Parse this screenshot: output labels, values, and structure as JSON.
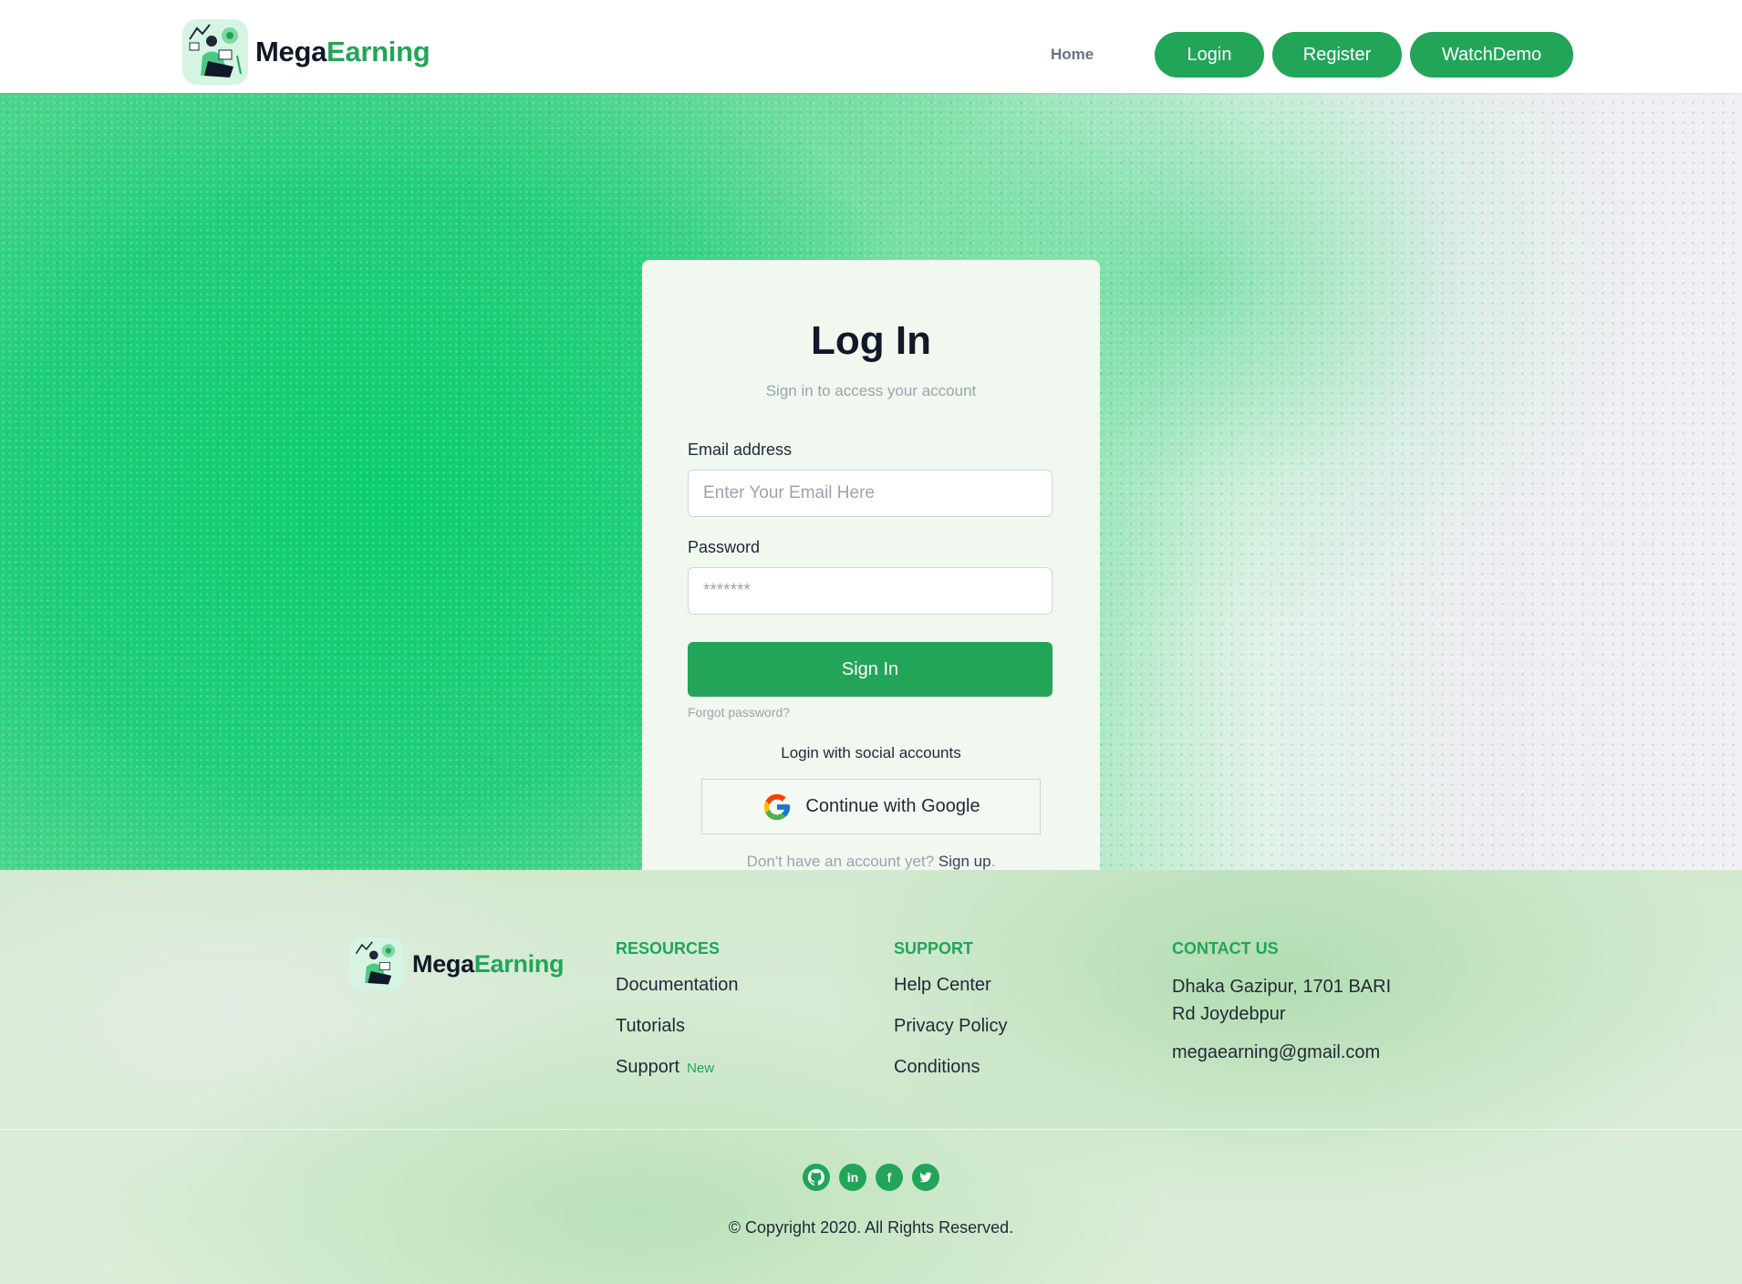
{
  "navbar": {
    "brand": {
      "part1": "Mega",
      "part2": "Earning"
    },
    "home": "Home",
    "login": "Login",
    "register": "Register",
    "watch_demo": "WatchDemo"
  },
  "login": {
    "title": "Log In",
    "subtitle": "Sign in to access your account",
    "email_label": "Email address",
    "email_placeholder": "Enter Your Email Here",
    "password_label": "Password",
    "password_placeholder": "*******",
    "signin_button": "Sign In",
    "forgot": "Forgot password?",
    "social_label": "Login with social accounts",
    "google_button": "Continue with Google",
    "no_account": "Don't have an account yet?",
    "signup": "Sign up",
    "signup_suffix": "."
  },
  "footer": {
    "brand": {
      "part1": "Mega",
      "part2": "Earning"
    },
    "resources": {
      "heading": "RESOURCES",
      "items": [
        "Documentation",
        "Tutorials",
        "Support"
      ],
      "support_badge": "New"
    },
    "support": {
      "heading": "SUPPORT",
      "items": [
        "Help Center",
        "Privacy Policy",
        "Conditions"
      ]
    },
    "contact": {
      "heading": "CONTACT US",
      "address": "Dhaka Gazipur, 1701 BARI Rd Joydebpur",
      "email": "megaearning@gmail.com"
    },
    "socials": [
      "github-icon",
      "linkedin-icon",
      "facebook-icon",
      "twitter-icon"
    ],
    "copyright": "© Copyright 2020. All Rights Reserved."
  },
  "colors": {
    "accent": "#22a559",
    "card_bg": "#f0f8ef",
    "footer_bg": "#d6ebd3"
  }
}
